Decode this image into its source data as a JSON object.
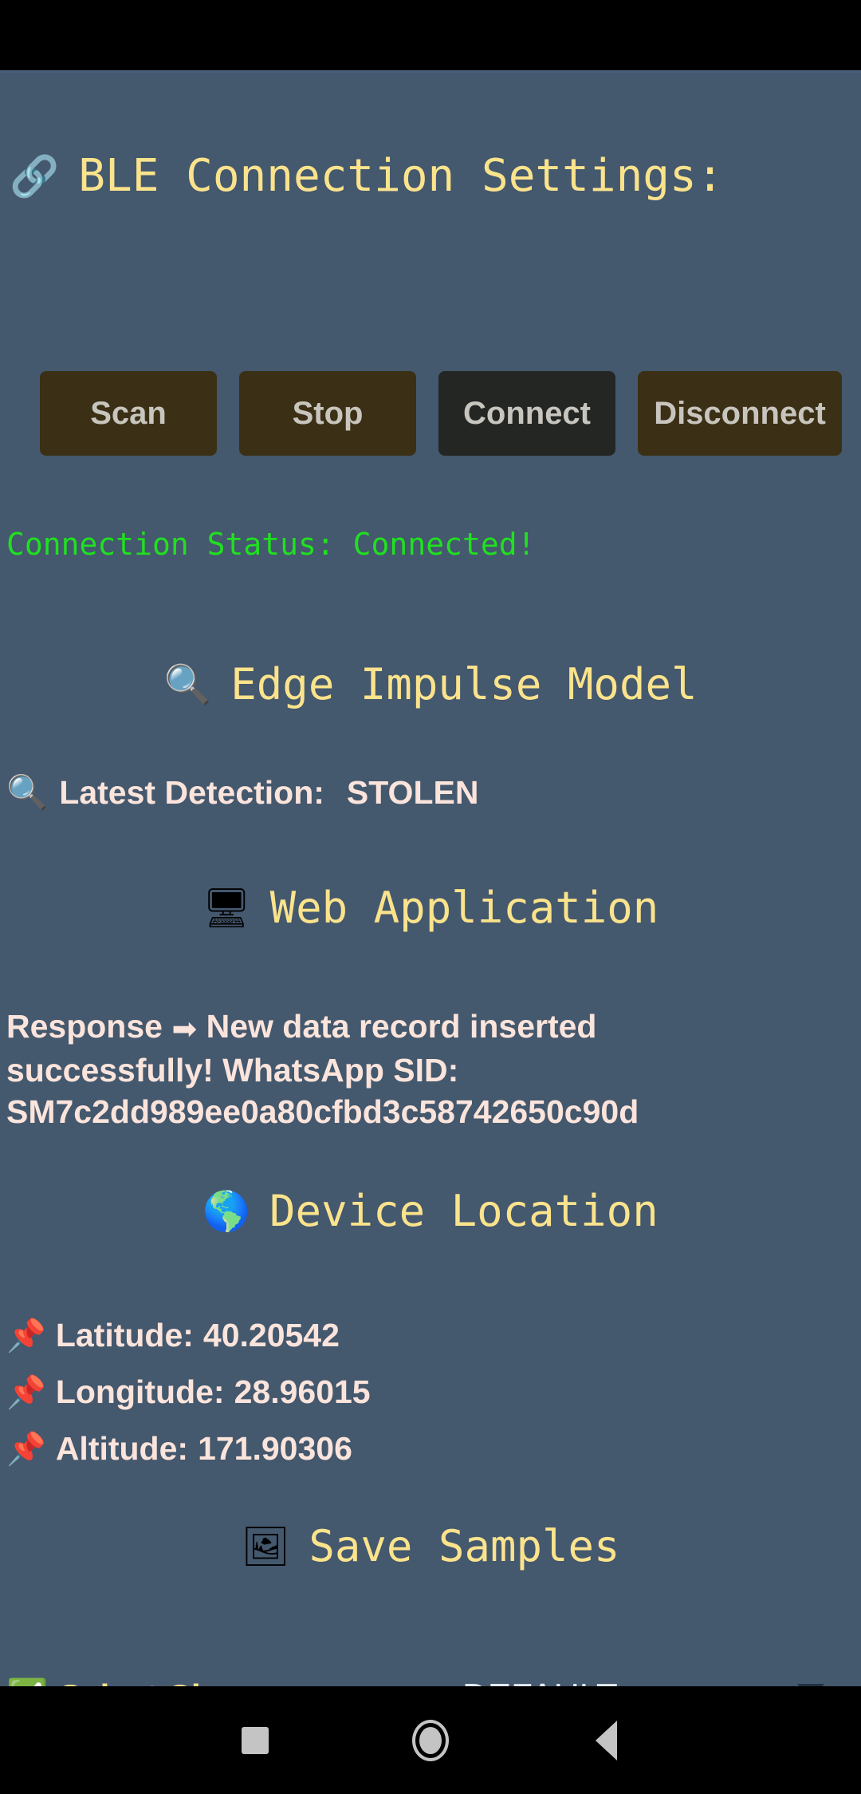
{
  "app": {
    "background_color": "#44586E",
    "accent_yellow": "#FBE38C",
    "status_green": "#20E020",
    "body_text_color": "#FBE4DB"
  },
  "header": {
    "icon": "link-chain-icon",
    "icon_glyph": "🔗",
    "title": "BLE Connection Settings:"
  },
  "buttons": [
    {
      "label": "Scan",
      "name": "scan-button",
      "color": "#3B3015"
    },
    {
      "label": "Stop",
      "name": "stop-button",
      "color": "#3B3015"
    },
    {
      "label": "Connect",
      "name": "connect-button",
      "color": "#232623"
    },
    {
      "label": "Disconnect",
      "name": "disconnect-button",
      "color": "#3B3015"
    }
  ],
  "connection": {
    "status_line": "Connection Status: Connected!",
    "status_color": "#20E020"
  },
  "edge_impulse": {
    "icon_glyph": "🔍",
    "heading": "Edge Impulse Model",
    "detection_icon_glyph": "🔍",
    "detection_label": "Latest Detection:",
    "detection_value": "STOLEN"
  },
  "web_application": {
    "icon_glyph": "🖥",
    "heading": "Web Application",
    "response_prefix": "Response ",
    "response_arrow_glyph": "➡",
    "response_body": " New data record inserted successfully! WhatsApp SID: SM7c2dd989ee0a80cfbd3c58742650c90d"
  },
  "device_location": {
    "icon_glyph": "🌎",
    "heading": "Device Location",
    "pin_glyph": "📌",
    "rows": [
      {
        "label": "Latitude:",
        "value": "40.20542"
      },
      {
        "label": "Longitude:",
        "value": "28.96015"
      },
      {
        "label": "Altitude:",
        "value": "171.90306"
      }
    ]
  },
  "save_samples": {
    "icon_glyph": "🖼",
    "heading": "Save Samples",
    "select_icon_glyph": "✅",
    "select_label": "Select Class:",
    "selected_option": "DEFAULT",
    "caret": "chevron-down-icon"
  },
  "navigation_bar": {
    "recents": "recents-square-icon",
    "home": "home-circle-icon",
    "back": "back-triangle-icon"
  }
}
